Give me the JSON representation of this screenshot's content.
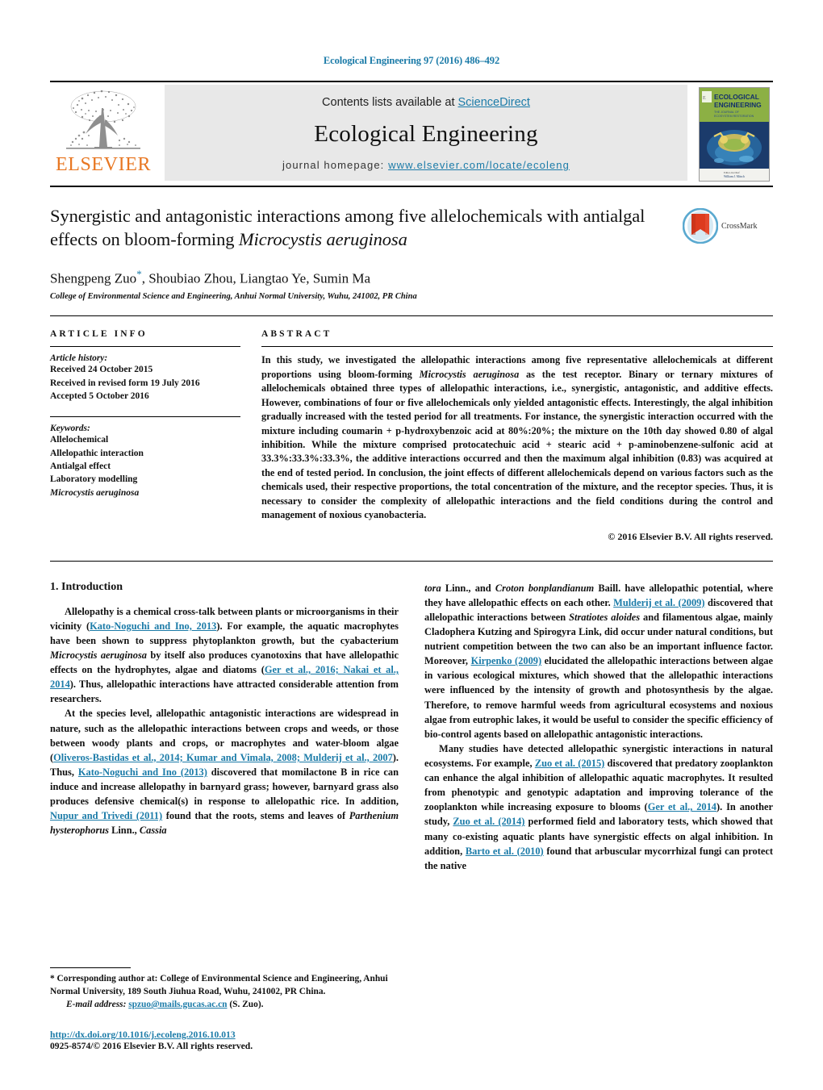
{
  "running_head": "Ecological Engineering 97 (2016) 486–492",
  "masthead": {
    "publisher_name": "ELSEVIER",
    "contents_prefix": "Contents lists available at ",
    "contents_link": "ScienceDirect",
    "journal_name": "Ecological Engineering",
    "homepage_prefix": "journal homepage: ",
    "homepage_url": "www.elsevier.com/locate/ecoleng",
    "cover_title_line1": "ECOLOGICAL",
    "cover_title_line2": "ENGINEERING"
  },
  "article": {
    "title_part1": "Synergistic and antagonistic interactions among five allelochemicals with antialgal effects on bloom-forming ",
    "title_italic": "Microcystis aeruginosa",
    "authors": "Shengpeng Zuo",
    "authors_rest": ", Shoubiao Zhou, Liangtao Ye, Sumin Ma",
    "affiliation": "College of Environmental Science and Engineering, Anhui Normal University, Wuhu, 241002, PR China",
    "crossmark_label": "CrossMark"
  },
  "info": {
    "heading": "ARTICLE INFO",
    "history_title": "Article history:",
    "history": [
      "Received 24 October 2015",
      "Received in revised form 19 July 2016",
      "Accepted 5 October 2016"
    ],
    "keywords_title": "Keywords:",
    "keywords": [
      "Allelochemical",
      "Allelopathic interaction",
      "Antialgal effect",
      "Laboratory modelling"
    ],
    "keyword_italic": "Microcystis aeruginosa"
  },
  "abstract": {
    "heading": "ABSTRACT",
    "p1": "In this study, we investigated the allelopathic interactions among five representative allelochemicals at different proportions using bloom-forming ",
    "organism": "Microcystis aeruginosa",
    "p2": " as the test receptor. Binary or ternary mixtures of allelochemicals obtained three types of allelopathic interactions, i.e., synergistic, antagonistic, and additive effects. However, combinations of four or five allelochemicals only yielded antagonistic effects. Interestingly, the algal inhibition gradually increased with the tested period for all treatments. For instance, the synergistic interaction occurred with the mixture including coumarin + p-hydroxybenzoic acid at 80%:20%; the mixture on the 10th day showed 0.80 of algal inhibition. While the mixture comprised protocatechuic acid + stearic acid + p-aminobenzene-sulfonic acid at 33.3%:33.3%:33.3%, the additive interactions occurred and then the maximum algal inhibition (0.83) was acquired at the end of tested period. In conclusion, the joint effects of different allelochemicals depend on various factors such as the chemicals used, their respective proportions, the total concentration of the mixture, and the receptor species. Thus, it is necessary to consider the complexity of allelopathic interactions and the field conditions during the control and management of noxious cyanobacteria.",
    "copyright": "© 2016 Elsevier B.V. All rights reserved."
  },
  "introduction": {
    "section_number_title": "1.  Introduction",
    "left": {
      "p1_a": "Allelopathy is a chemical cross-talk between plants or microorganisms in their vicinity (",
      "p1_ref1": "Kato-Noguchi and Ino, 2013",
      "p1_b": "). For example, the aquatic macrophytes have been shown to suppress phytoplankton growth, but the cyabacterium ",
      "p1_it1": "Microcystis aeruginosa",
      "p1_c": " by itself also produces cyanotoxins that have allelopathic effects on the hydrophytes, algae and diatoms (",
      "p1_ref2": "Ger et al., 2016; Nakai et al., 2014",
      "p1_d": "). Thus, allelopathic interactions have attracted considerable attention from researchers.",
      "p2_a": "At the species level, allelopathic antagonistic interactions are widespread in nature, such as the allelopathic interactions between crops and weeds, or those between woody plants and crops, or macrophytes and water-bloom algae (",
      "p2_ref1": "Oliveros-Bastidas et al., 2014; Kumar and Vimala, 2008; Mulderij et al., 2007",
      "p2_b": "). Thus, ",
      "p2_ref2": "Kato-Noguchi and Ino (2013)",
      "p2_c": " discovered that momilactone B in rice can induce and increase allelopathy in barnyard grass; however, barnyard grass also produces defensive chemical(s) in response to allelopathic rice. In addition, ",
      "p2_ref3": "Nupur and Trivedi (2011)",
      "p2_d": " found that the roots, stems and leaves of ",
      "p2_it1": "Parthenium hysterophorus",
      "p2_e": " Linn., ",
      "p2_it2": "Cassia"
    },
    "right": {
      "p2_cont_it": "tora",
      "p2_cont_a": " Linn., and ",
      "p2_cont_it2": "Croton bonplandianum",
      "p2_cont_b": " Baill. have allelopathic potential, where they have allelopathic effects on each other. ",
      "p2_cont_ref1": "Mulderij et al. (2009)",
      "p2_cont_c": " discovered that allelopathic interactions between ",
      "p2_cont_it3": "Stratiotes aloides",
      "p2_cont_d": " and filamentous algae, mainly Cladophera Kutzing and Spirogyra Link, did occur under natural conditions, but nutrient competition between the two can also be an important influence factor. Moreover, ",
      "p2_cont_ref2": "Kirpenko (2009)",
      "p2_cont_e": " elucidated the allelopathic interactions between algae in various ecological mixtures, which showed that the allelopathic interactions were influenced by the intensity of growth and photosynthesis by the algae. Therefore, to remove harmful weeds from agricultural ecosystems and noxious algae from eutrophic lakes, it would be useful to consider the specific efficiency of bio-control agents based on allelopathic antagonistic interactions.",
      "p3_a": "Many studies have detected allelopathic synergistic interactions in natural ecosystems. For example, ",
      "p3_ref1": "Zuo et al. (2015)",
      "p3_b": " discovered that predatory zooplankton can enhance the algal inhibition of allelopathic aquatic macrophytes. It resulted from phenotypic and genotypic adaptation and improving tolerance of the zooplankton while increasing exposure to blooms (",
      "p3_ref2": "Ger et al., 2014",
      "p3_c": "). In another study, ",
      "p3_ref3": "Zuo et al. (2014)",
      "p3_d": " performed field and laboratory tests, which showed that many co-existing aquatic plants have synergistic effects on algal inhibition. In addition, ",
      "p3_ref4": "Barto et al. (2010)",
      "p3_e": " found that arbuscular mycorrhizal fungi can protect the native"
    }
  },
  "footnote": {
    "corresponding_star": "*",
    "corresponding_text": " Corresponding author at: College of Environmental Science and Engineering, Anhui Normal University, 189 South Jiuhua Road, Wuhu, 241002, PR China.",
    "email_label": "E-mail address:",
    "email": "spzuo@mails.gucas.ac.cn",
    "email_suffix": " (S. Zuo).",
    "doi": "http://dx.doi.org/10.1016/j.ecoleng.2016.10.013",
    "issn": "0925-8574/© 2016 Elsevier B.V. All rights reserved."
  },
  "colors": {
    "link": "#1b7ba8",
    "elsevier_orange": "#e87722",
    "masthead_gray": "#e8e8e8"
  }
}
